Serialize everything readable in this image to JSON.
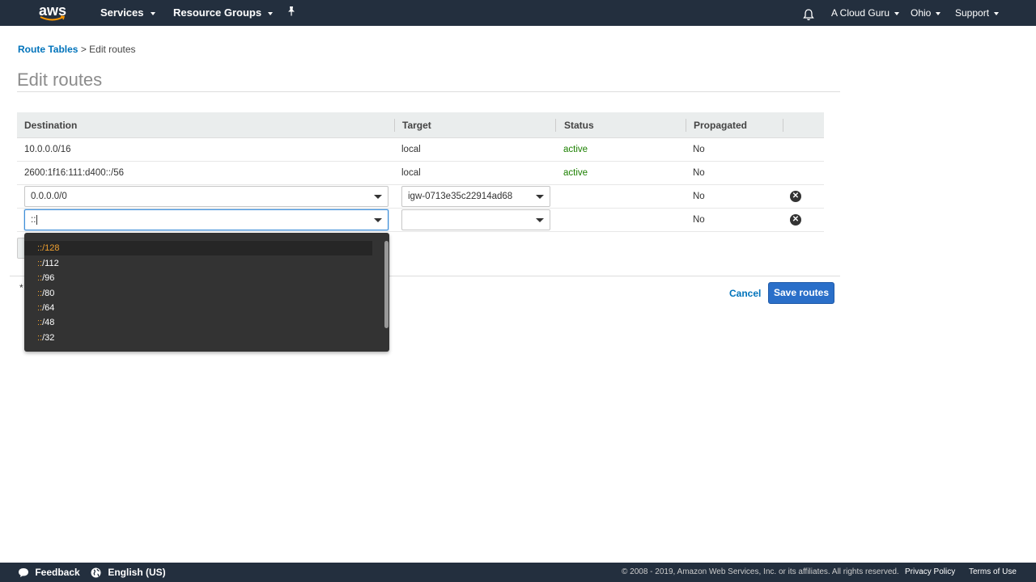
{
  "topbar": {
    "logo_text": "aws",
    "services": "Services",
    "resource_groups": "Resource Groups",
    "pin_icon": "pin-icon",
    "bell_icon": "bell-icon",
    "account": "A Cloud Guru",
    "region": "Ohio",
    "support": "Support"
  },
  "breadcrumb": {
    "link": "Route Tables",
    "sep": ">",
    "current": "Edit routes"
  },
  "page": {
    "title": "Edit routes"
  },
  "table": {
    "headers": [
      "Destination",
      "Target",
      "Status",
      "Propagated"
    ],
    "rows": [
      {
        "destination": "10.0.0.0/16",
        "target": "local",
        "status": "active",
        "propagated": "No"
      },
      {
        "destination": "2600:1f16:111:d400::/56",
        "target": "local",
        "status": "active",
        "propagated": "No"
      }
    ],
    "edit_rows": [
      {
        "destination": "0.0.0.0/0",
        "target": "igw-0713e35c22914ad68",
        "propagated": "No"
      },
      {
        "destination": "::",
        "target": "",
        "propagated": "No"
      }
    ]
  },
  "dropdown": {
    "prefix": "::",
    "items": [
      "/128",
      "/112",
      "/96",
      "/80",
      "/64",
      "/48",
      "/32"
    ]
  },
  "actions": {
    "required_mark": "*",
    "cancel": "Cancel",
    "save": "Save routes"
  },
  "footer": {
    "feedback": "Feedback",
    "language": "English (US)",
    "copyright": "© 2008 - 2019, Amazon Web Services, Inc. or its affiliates. All rights reserved.",
    "privacy": "Privacy Policy",
    "terms": "Terms of Use"
  },
  "colors": {
    "nav_bg": "#232f3e",
    "link": "#0073bb",
    "active": "#1d8102",
    "primary_button": "#2a6fc9",
    "dropdown_bg": "#333333",
    "match_highlight": "#f0a030"
  }
}
